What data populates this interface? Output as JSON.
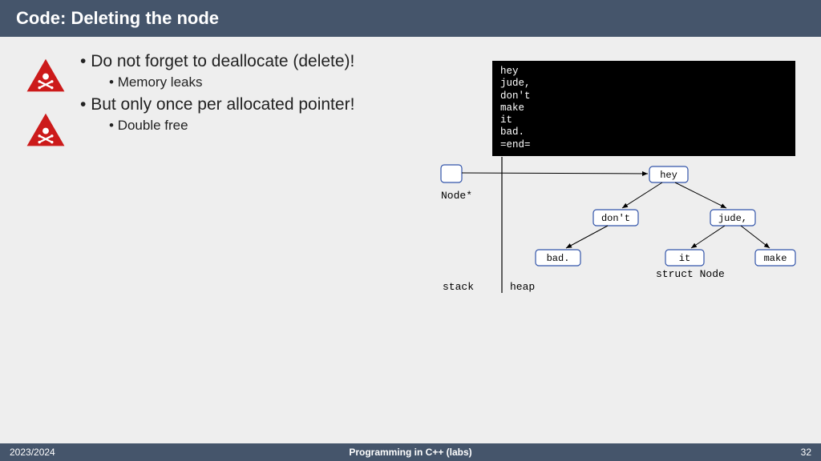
{
  "header": {
    "title": "Code: Deleting the node"
  },
  "bullets": {
    "item1": "Do not forget to deallocate (delete)!",
    "item1sub": "Memory leaks",
    "item2": "But only once per allocated pointer!",
    "item2sub": "Double free"
  },
  "terminal": {
    "lines": "hey\njude,\ndon't\nmake\nit\nbad.\n=end="
  },
  "diagram": {
    "stack_label": "stack",
    "heap_label": "heap",
    "pointer_label": "Node*",
    "struct_label": "struct Node",
    "nodes": {
      "root": "hey",
      "l": "don't",
      "r": "jude,",
      "ll": "bad.",
      "rl": "it",
      "rr": "make"
    }
  },
  "footer": {
    "year": "2023/2024",
    "course": "Programming in C++ (labs)",
    "page": "32"
  }
}
